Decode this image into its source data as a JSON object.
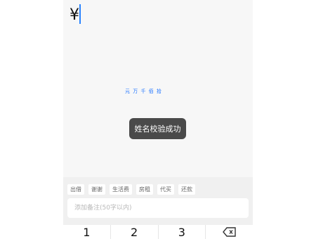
{
  "amount": {
    "currency_symbol": "¥",
    "hint": "元 万 千 佰 拾"
  },
  "toast": {
    "text": "姓名校验成功"
  },
  "purpose_tags": [
    "出借",
    "谢谢",
    "生活费",
    "房租",
    "代买",
    "还款"
  ],
  "remark": {
    "placeholder": "添加备注(50字以内)"
  },
  "keypad": {
    "keys": [
      "1",
      "2",
      "3"
    ],
    "backspace_icon": "backspace-icon"
  },
  "colors": {
    "cursor": "#2a84ff",
    "toast_bg": "#4a4a4a",
    "hint": "#1b72ff"
  }
}
